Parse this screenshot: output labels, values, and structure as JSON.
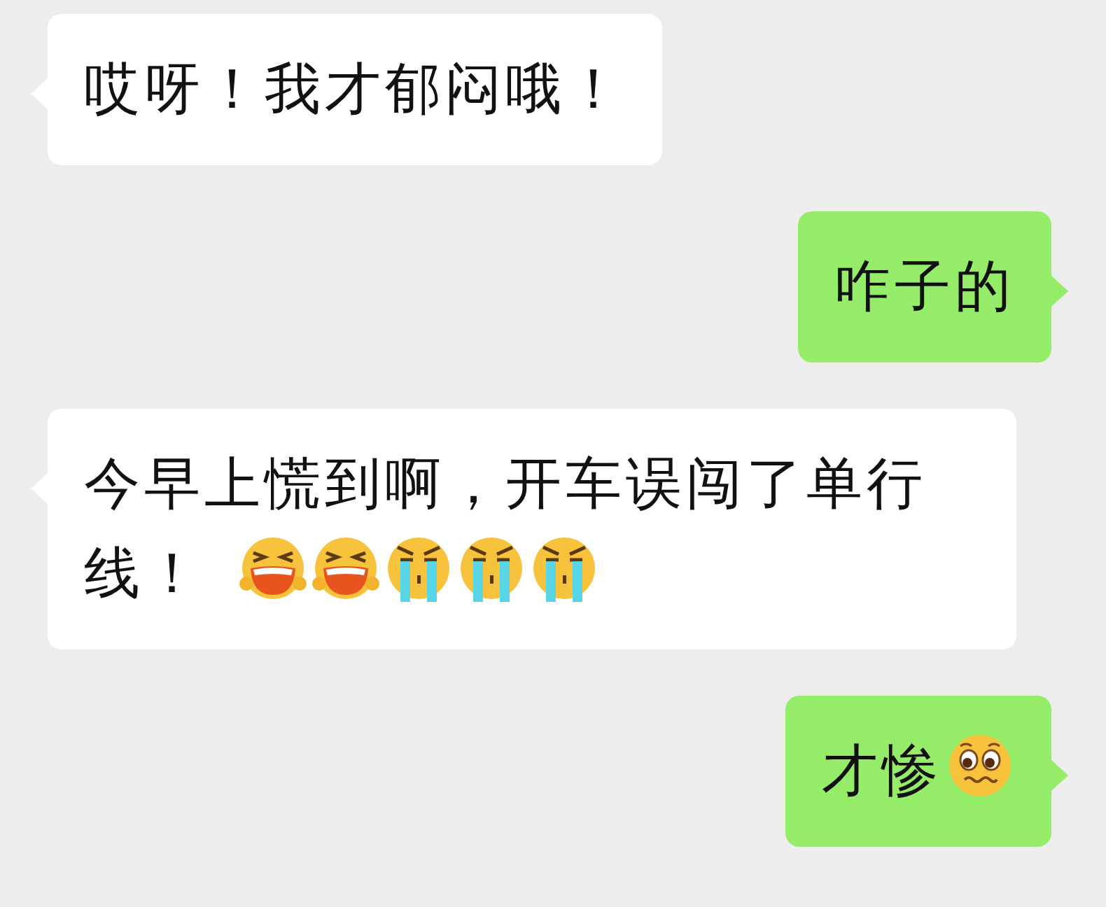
{
  "messages": [
    {
      "kind": "received",
      "text": "哎呀！我才郁闷哦！"
    },
    {
      "kind": "sent",
      "text": "咋子的"
    },
    {
      "kind": "received",
      "text": "今早上慌到啊，开车误闯了单行线！",
      "emojis": [
        {
          "kind": "laughing"
        },
        {
          "kind": "laughing"
        },
        {
          "kind": "crying"
        },
        {
          "kind": "crying"
        },
        {
          "kind": "crying"
        }
      ]
    },
    {
      "kind": "sent",
      "text": "才惨",
      "emojis": [
        {
          "kind": "worried"
        }
      ]
    }
  ]
}
